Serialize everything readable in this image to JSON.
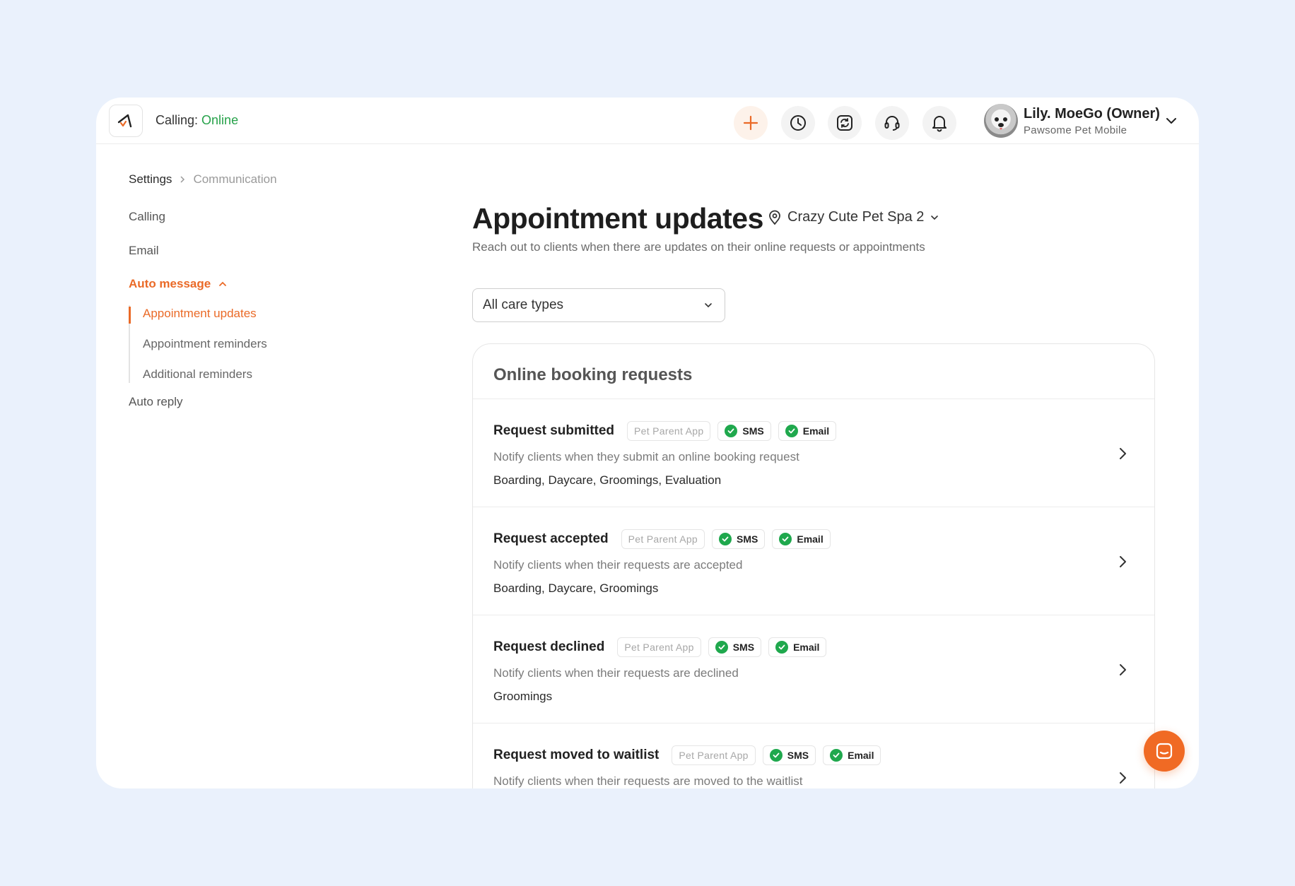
{
  "header": {
    "calling_label": "Calling:",
    "calling_status": "Online",
    "user_name": "Lily. MoeGo (Owner)",
    "business_name": "Pawsome Pet Mobile"
  },
  "breadcrumb": {
    "root": "Settings",
    "current": "Communication"
  },
  "sidebar": {
    "items": [
      "Calling",
      "Email"
    ],
    "auto_message": "Auto message",
    "sub_items": [
      "Appointment updates",
      "Appointment reminders",
      "Additional reminders"
    ],
    "auto_reply": "Auto reply"
  },
  "main": {
    "title": "Appointment updates",
    "location": "Crazy Cute Pet Spa 2",
    "description": "Reach out to clients when there are updates on their online requests or appointments",
    "care_select": "All care types",
    "section_title": "Online booking requests",
    "channel_labels": {
      "app": "Pet Parent App",
      "sms": "SMS",
      "email": "Email"
    },
    "rows": [
      {
        "name": "Request submitted",
        "desc": "Notify clients when they submit an online booking request",
        "types": "Boarding, Daycare, Groomings, Evaluation"
      },
      {
        "name": "Request accepted",
        "desc": "Notify clients when their requests are accepted",
        "types": "Boarding, Daycare, Groomings"
      },
      {
        "name": "Request declined",
        "desc": "Notify clients when their requests are declined",
        "types": "Groomings"
      },
      {
        "name": "Request moved to waitlist",
        "desc": "Notify clients when their requests are moved to the waitlist",
        "types": ""
      }
    ]
  },
  "colors": {
    "accent": "#ea6a27",
    "online": "#26a24a",
    "check": "#1fa84d",
    "background": "#eaf1fc"
  },
  "icons": [
    "logo-icon",
    "plus-icon",
    "clock-icon",
    "sync-icon",
    "headset-icon",
    "bell-icon",
    "chevron-down-icon",
    "location-pin-icon",
    "check-icon",
    "chevron-right-icon",
    "chat-icon"
  ]
}
